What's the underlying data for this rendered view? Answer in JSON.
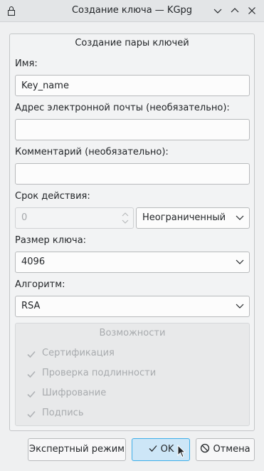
{
  "window": {
    "title": "Создание ключа — KGpg"
  },
  "group": {
    "title": "Создание пары ключей"
  },
  "form": {
    "name_label": "Имя:",
    "name_value": "Key_name",
    "email_label": "Адрес электронной почты (необязательно):",
    "email_value": "",
    "comment_label": "Комментарий (необязательно):",
    "comment_value": "",
    "expiry_label": "Срок действия:",
    "expiry_value": "0",
    "expiry_unit": "Неограниченный",
    "keysize_label": "Размер ключа:",
    "keysize_value": "4096",
    "algorithm_label": "Алгоритм:",
    "algorithm_value": "RSA"
  },
  "capabilities": {
    "title": "Возможности",
    "items": [
      {
        "label": "Сертификация",
        "checked": true
      },
      {
        "label": "Проверка подлинности",
        "checked": true
      },
      {
        "label": "Шифрование",
        "checked": true
      },
      {
        "label": "Подпись",
        "checked": true
      }
    ]
  },
  "buttons": {
    "expert": "Экспертный режим",
    "ok": "OK",
    "cancel": "Отмена"
  },
  "icons": {
    "lock": "lock-icon",
    "minimize": "chevron-down-icon",
    "maximize": "chevron-up-icon",
    "close": "close-icon",
    "ok": "checkmark-icon",
    "cancel": "cancel-icon"
  },
  "colors": {
    "accent": "#3daee9",
    "ok_button_bg": "#cde6f7"
  }
}
